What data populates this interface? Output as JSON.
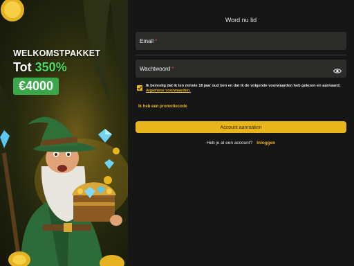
{
  "promo": {
    "line1": "WELKOMSTPAKKET",
    "line2_prefix": "Tot ",
    "line2_percent": "350%",
    "amount": "€4000"
  },
  "form": {
    "title": "Word nu lid",
    "email_label": "Email",
    "password_label": "Wachtwoord",
    "required_mark": "*",
    "consent_text": "Ik bevestig dat ik ten minste 18 jaar oud ben en dat ik de volgende voorwaarden heb gelezen en aanvaard: ",
    "consent_link": "Algemene voorwaarden.",
    "promo_code_link": "Ik heb een promotiecode",
    "submit_label": "Account aanmaken",
    "have_account_text": "Heb je al een account?",
    "login_link": "Inloggen"
  },
  "colors": {
    "accent": "#e9b51c",
    "background": "#161616",
    "field": "#2c2c2a",
    "promo_green": "#4cdb5a",
    "amount_badge": "#3aa84a",
    "required": "#e23c3c"
  },
  "icons": {
    "password_toggle": "eye-icon",
    "checkbox_state": "checked"
  }
}
